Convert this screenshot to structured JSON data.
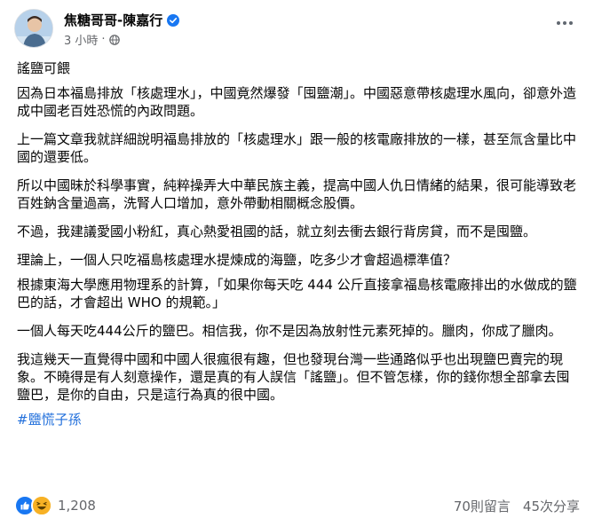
{
  "post": {
    "author": "焦糖哥哥-陳嘉行",
    "time": "3 小時",
    "time_separator": "·",
    "title": "謠鹽可餵",
    "paragraphs": [
      "因為日本福島排放「核處理水」，中國竟然爆發「囤鹽潮」。中國惡意帶核處理水風向，卻意外造成中國老百姓恐慌的內政問題。",
      "上一篇文章我就詳細說明福島排放的「核處理水」跟一般的核電廠排放的一樣，甚至氚含量比中國的還要低。",
      "所以中國昧於科學事實，純粹操弄大中華民族主義，提高中國人仇日情緒的結果，很可能導致老百姓鈉含量過高，洗腎人口增加，意外帶動相關概念股價。",
      "不過，我建議愛國小粉紅，真心熱愛祖國的話，就立刻去衝去銀行背房貸，而不是囤鹽。",
      "理論上，一個人只吃福島核處理水提煉成的海鹽，吃多少才會超過標準值？",
      "根據東海大學應用物理系的計算，「如果你每天吃 444 公斤直接拿福島核電廠排出的水做成的鹽巴的話，才會超出 WHO 的規範。」",
      "一個人每天吃444公斤的鹽巴。相信我，你不是因為放射性元素死掉的。臘肉，你成了臘肉。",
      "我這幾天一直覺得中國和中國人很瘋很有趣，但也發現台灣一些通路似乎也出現鹽巴賣完的現象。不曉得是有人刻意操作，還是真的有人誤信「謠鹽」。但不管怎樣，你的錢你想全部拿去囤鹽巴，是你的自由，只是這行為真的很中國。"
    ],
    "hashtag": "#鹽慌子孫"
  },
  "footer": {
    "reaction_count": "1,208",
    "comments": "70則留言",
    "shares": "45次分享"
  },
  "colors": {
    "link": "#216fdb",
    "verified": "#1877f2",
    "meta": "#65676b"
  },
  "icons": [
    "verified-badge-icon",
    "globe-icon",
    "more-options-icon",
    "like-reaction-icon",
    "haha-reaction-icon"
  ]
}
